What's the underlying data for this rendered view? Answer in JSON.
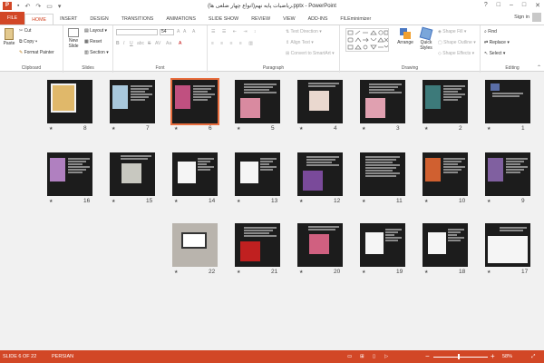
{
  "window": {
    "title": "ریاضیات پایه نهم(انواع چهار ضلعی ها).pptx - PowerPoint",
    "app_logo": "P",
    "controls": [
      "?",
      "□",
      "–",
      "□",
      "✕"
    ]
  },
  "tabs": [
    "FILE",
    "HOME",
    "INSERT",
    "DESIGN",
    "TRANSITIONS",
    "ANIMATIONS",
    "SLIDE SHOW",
    "REVIEW",
    "VIEW",
    "ADD-INS",
    "FILEminimizer"
  ],
  "active_tab": "HOME",
  "account": {
    "signin": "Sign in"
  },
  "ribbon": {
    "clipboard": {
      "label": "Clipboard",
      "paste": "Paste",
      "cut": "Cut",
      "copy": "Copy",
      "format_painter": "Format Painter"
    },
    "slides": {
      "label": "Slides",
      "new_slide": "New",
      "new_slide2": "Slide",
      "layout": "Layout",
      "reset": "Reset",
      "section": "Section"
    },
    "font": {
      "label": "Font",
      "size": "54",
      "bold": "B",
      "italic": "I",
      "underline": "U",
      "strike": "S",
      "shadow": "abc",
      "spacing": "AV",
      "case": "Aa",
      "font_color": "A",
      "grow": "A",
      "shrink": "A",
      "clear": "A"
    },
    "paragraph": {
      "label": "Paragraph",
      "text_direction": "Text Direction",
      "align_text": "Align Text",
      "smartart": "Convert to SmartArt"
    },
    "drawing": {
      "label": "Drawing",
      "arrange": "Arrange",
      "quick_styles": "Quick",
      "quick_styles2": "Styles",
      "shape_fill": "Shape Fill",
      "shape_outline": "Shape Outline",
      "shape_effects": "Shape Effects"
    },
    "editing": {
      "label": "Editing",
      "find": "Find",
      "replace": "Replace",
      "select": "Select"
    }
  },
  "slides": [
    {
      "num": "1",
      "type": "title",
      "photo": "#5a6ea8"
    },
    {
      "num": "2",
      "type": "photo-left",
      "photo": "#3d7a7a"
    },
    {
      "num": "3",
      "type": "photo-bottom",
      "photo": "#e0a0b0"
    },
    {
      "num": "4",
      "type": "photo-center",
      "photo": "#ead8cf"
    },
    {
      "num": "5",
      "type": "photo-bottom",
      "photo": "#d98aa0"
    },
    {
      "num": "6",
      "type": "photo-left",
      "photo": "#c05080",
      "selected": true
    },
    {
      "num": "7",
      "type": "photo-left",
      "photo": "#a8c8dc"
    },
    {
      "num": "8",
      "type": "photo-big",
      "photo": "#e0b86a"
    },
    {
      "num": "9",
      "type": "photo-left",
      "photo": "#8060a0"
    },
    {
      "num": "10",
      "type": "photo-left",
      "photo": "#d06030"
    },
    {
      "num": "11",
      "type": "text",
      "photo": ""
    },
    {
      "num": "12",
      "type": "photo-bottom",
      "photo": "#7a4a9a"
    },
    {
      "num": "13",
      "type": "diagram",
      "photo": ""
    },
    {
      "num": "14",
      "type": "diagram",
      "photo": ""
    },
    {
      "num": "15",
      "type": "photo-center",
      "photo": "#c8c8c0"
    },
    {
      "num": "16",
      "type": "photo-left",
      "photo": "#b080c0"
    },
    {
      "num": "17",
      "type": "whiteboard",
      "photo": ""
    },
    {
      "num": "18",
      "type": "diagram",
      "photo": ""
    },
    {
      "num": "19",
      "type": "diagram",
      "photo": ""
    },
    {
      "num": "20",
      "type": "photo-center",
      "photo": "#d06080"
    },
    {
      "num": "21",
      "type": "photo-bottom",
      "photo": "#c02020"
    },
    {
      "num": "22",
      "type": "laptop",
      "photo": "#a0a0a0"
    }
  ],
  "status": {
    "slide_info": "SLIDE 6 OF 22",
    "language": "PERSIAN",
    "zoom": "58%",
    "zoom_minus": "−",
    "zoom_plus": "+"
  },
  "colors": {
    "accent": "#d24726",
    "selection": "#e86d3e"
  }
}
